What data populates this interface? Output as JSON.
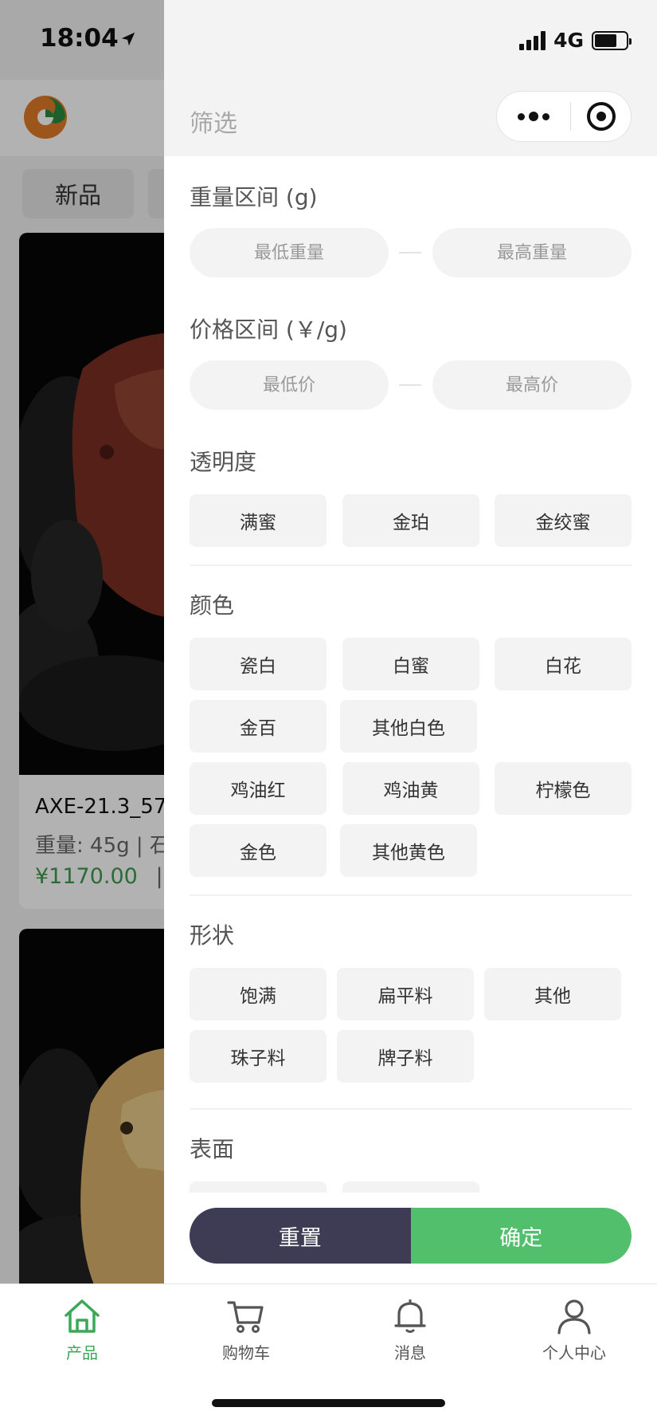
{
  "status": {
    "time": "18:04",
    "network": "4G"
  },
  "background": {
    "chip_new": "新品",
    "product": {
      "title": "AXE-21.3_57",
      "meta": "重量: 45g | 石",
      "price": "¥1170.00",
      "price_sep": "|"
    }
  },
  "filter": {
    "title": "筛选",
    "weight": {
      "label": "重量区间 (g)",
      "min_placeholder": "最低重量",
      "max_placeholder": "最高重量"
    },
    "price": {
      "label": "价格区间 (￥/g)",
      "min_placeholder": "最低价",
      "max_placeholder": "最高价"
    },
    "transparency": {
      "label": "透明度",
      "options": [
        "满蜜",
        "金珀",
        "金绞蜜"
      ]
    },
    "color": {
      "label": "颜色",
      "options": [
        "瓷白",
        "白蜜",
        "白花",
        "金百",
        "其他白色",
        "鸡油红",
        "鸡油黄",
        "柠檬色",
        "金色",
        "其他黄色"
      ]
    },
    "shape": {
      "label": "形状",
      "options": [
        "饱满",
        "扁平料",
        "其他",
        "珠子料",
        "牌子料"
      ]
    },
    "surface": {
      "label": "表面"
    },
    "reset_label": "重置",
    "confirm_label": "确定"
  },
  "tabbar": {
    "items": [
      {
        "label": "产品",
        "icon": "home-icon",
        "active": true
      },
      {
        "label": "购物车",
        "icon": "cart-icon",
        "active": false
      },
      {
        "label": "消息",
        "icon": "bell-icon",
        "active": false
      },
      {
        "label": "个人中心",
        "icon": "user-icon",
        "active": false
      }
    ]
  },
  "colors": {
    "accent_green": "#52bf6c",
    "reset_dark": "#3e3c54",
    "price_green": "#3e9a4e"
  }
}
